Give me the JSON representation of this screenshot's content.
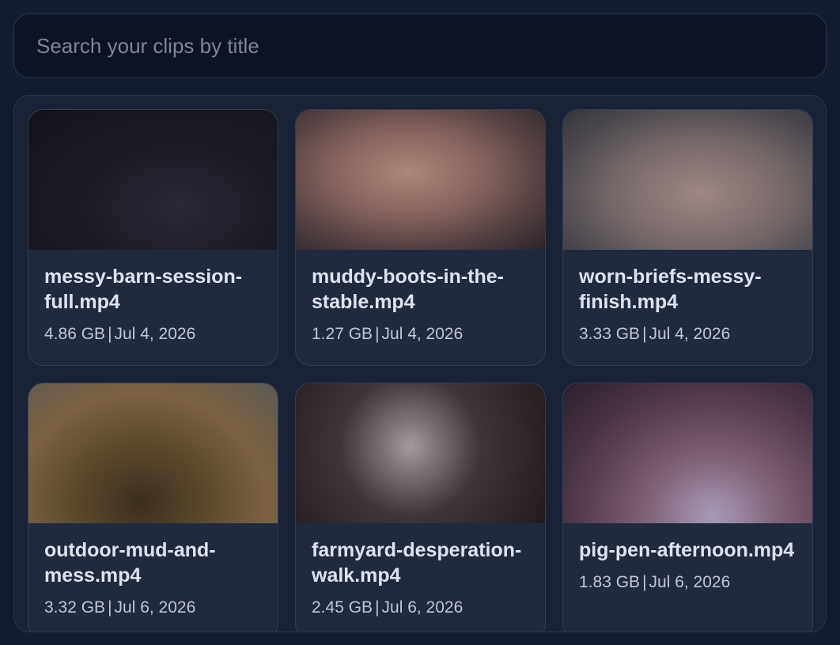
{
  "search": {
    "placeholder": "Search your clips by title",
    "value": ""
  },
  "clips": [
    {
      "title": "messy-barn-session-full.mp4",
      "size": "4.86 GB",
      "date": "Jul 4, 2026",
      "thumb": "radial-gradient(ellipse at 60% 70%, #2c2838 0%, #1d1b25 45%, #121219 100%)"
    },
    {
      "title": "muddy-boots-in-the-stable.mp4",
      "size": "1.27 GB",
      "date": "Jul 4, 2026",
      "thumb": "radial-gradient(ellipse at 45% 45%, #ad8579 0%, #8a6762 35%, #4b3b3d 75%, #2d2429 100%)"
    },
    {
      "title": "worn-briefs-messy-finish.mp4",
      "size": "3.33 GB",
      "date": "Jul 4, 2026",
      "thumb": "radial-gradient(ellipse at 55% 60%, #9c8784 0%, #7b6c6c 40%, #4d4a4f 75%, #333338 100%)"
    },
    {
      "title": "outdoor-mud-and-mess.mp4",
      "size": "3.32 GB",
      "date": "Jul 6, 2026",
      "thumb": "radial-gradient(ellipse at 45% 85%, #3a2e1d 0%, #5c4a2e 35%, #7a6142 65%, #5b5a55 100%)"
    },
    {
      "title": "farmyard-desperation-walk.mp4",
      "size": "2.45 GB",
      "date": "Jul 6, 2026",
      "thumb": "radial-gradient(circle at 46% 45%, #a39b9d 0%, #7a7173 18%, #3f3537 45%, #221b1d 100%)"
    },
    {
      "title": "pig-pen-afternoon.mp4",
      "size": "1.83 GB",
      "date": "Jul 6, 2026",
      "thumb": "radial-gradient(ellipse at 60% 95%, #a79bb7 0%, #7a5c6e 35%, #4a3445 70%, #2a1f2e 100%)"
    }
  ]
}
